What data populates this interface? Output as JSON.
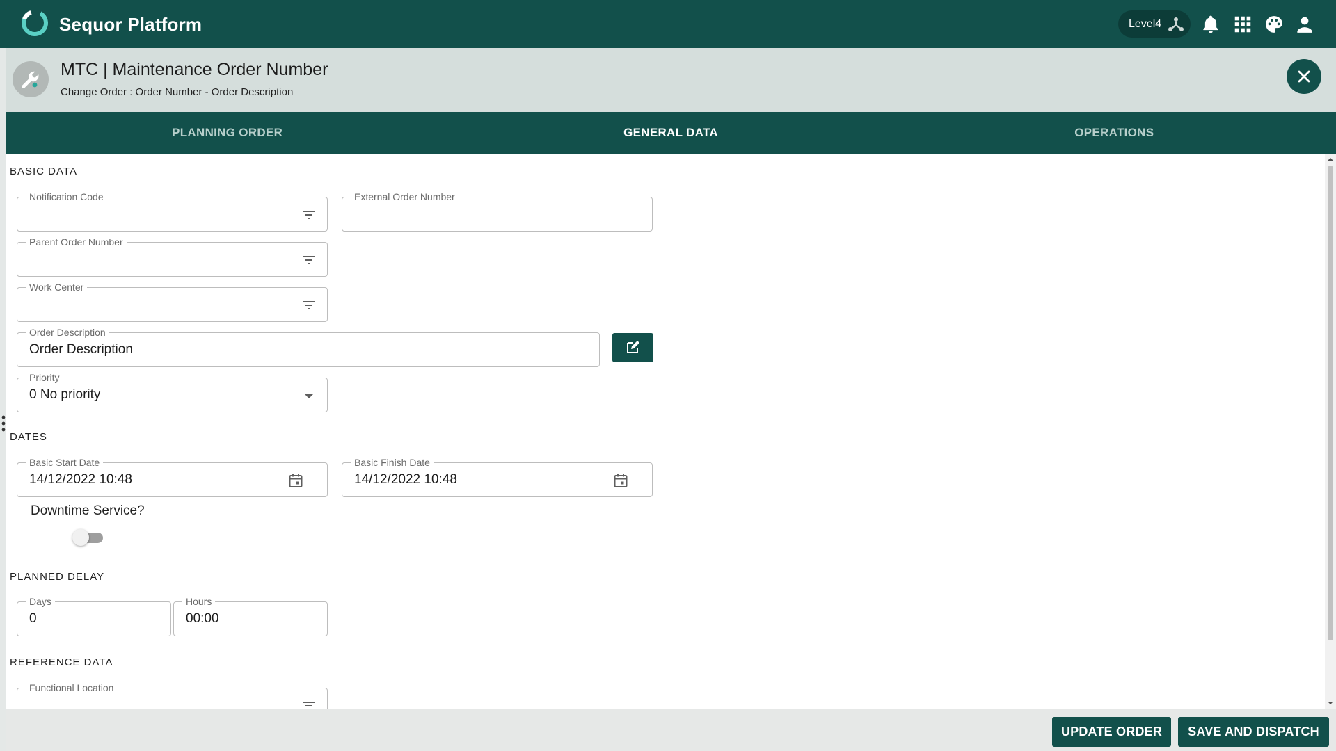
{
  "app": {
    "name": "Sequor Platform",
    "level": "Level4"
  },
  "header": {
    "title": "MTC | Maintenance Order Number",
    "subtitle": "Change Order : Order Number - Order Description"
  },
  "tabs": [
    {
      "label": "PLANNING ORDER",
      "active": false
    },
    {
      "label": "GENERAL DATA",
      "active": true
    },
    {
      "label": "OPERATIONS",
      "active": false
    }
  ],
  "sections": {
    "basic_data": "BASIC DATA",
    "dates": "DATES",
    "planned_delay": "PLANNED DELAY",
    "reference_data": "REFERENCE DATA"
  },
  "fields": {
    "notification_code": {
      "label": "Notification Code",
      "value": ""
    },
    "external_order_number": {
      "label": "External Order Number",
      "value": ""
    },
    "parent_order_number": {
      "label": "Parent Order Number",
      "value": ""
    },
    "work_center": {
      "label": "Work Center",
      "value": ""
    },
    "order_description": {
      "label": "Order Description",
      "value": "Order Description"
    },
    "priority": {
      "label": "Priority",
      "value": "0 No priority"
    },
    "basic_start_date": {
      "label": "Basic Start Date",
      "value": "14/12/2022 10:48"
    },
    "basic_finish_date": {
      "label": "Basic Finish Date",
      "value": "14/12/2022 10:48"
    },
    "downtime_service": {
      "label": "Downtime Service?",
      "checked": false
    },
    "days": {
      "label": "Days",
      "value": "0"
    },
    "hours": {
      "label": "Hours",
      "value": "00:00"
    },
    "functional_location": {
      "label": "Functional Location",
      "value": ""
    }
  },
  "footer": {
    "update_label": "UPDATE ORDER",
    "dispatch_label": "SAVE AND DISPATCH"
  },
  "colors": {
    "primary": "#12504b",
    "header_bg": "#d5dedc",
    "accent": "#26a69a"
  }
}
